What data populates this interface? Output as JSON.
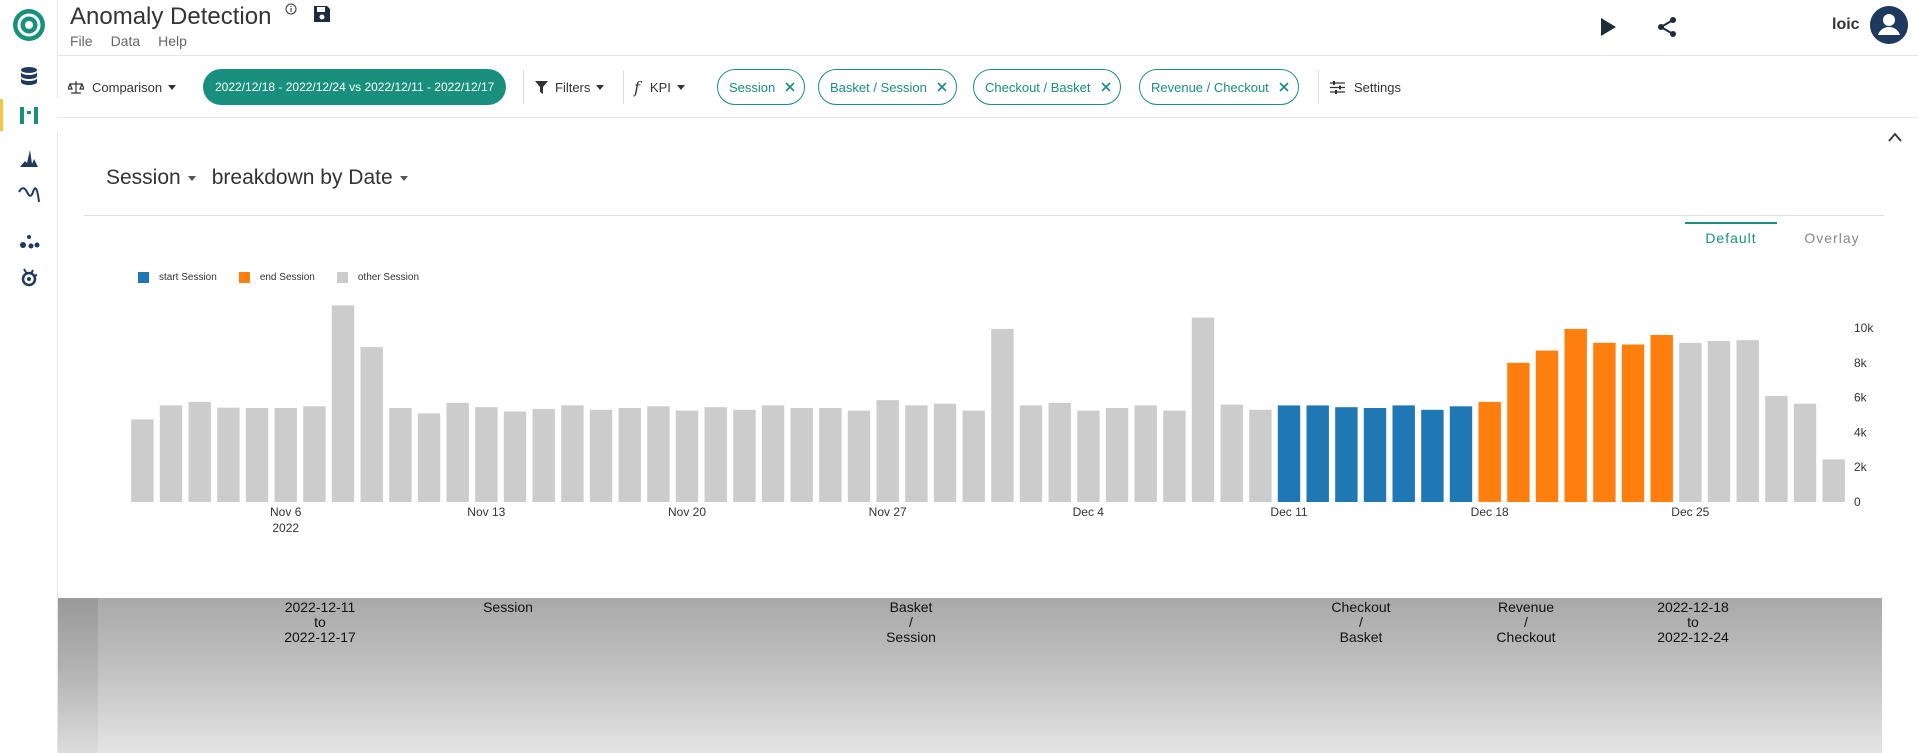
{
  "app": {
    "title": "Anomaly Detection",
    "menu": [
      "File",
      "Data",
      "Help"
    ],
    "user": "loic",
    "accent": "#19907e"
  },
  "toolbar": {
    "comparison_label": "Comparison",
    "date_range": "2022/12/18 - 2022/12/24 vs 2022/12/11 - 2022/12/17",
    "filters_label": "Filters",
    "kpi_label": "KPI",
    "chips": [
      "Session",
      "Basket / Session",
      "Checkout / Basket",
      "Revenue / Checkout"
    ],
    "settings_label": "Settings"
  },
  "panel": {
    "metric": "Session",
    "breakdown": "breakdown by Date",
    "view_tabs": [
      "Default",
      "Overlay"
    ],
    "active_tab": "Default"
  },
  "chart_data": {
    "type": "bar",
    "legend": [
      {
        "name": "start Session",
        "color": "#1f77b4"
      },
      {
        "name": "end Session",
        "color": "#ff7f0e"
      },
      {
        "name": "other Session",
        "color": "#cccccc"
      }
    ],
    "x_tick_labels": [
      {
        "label": "Nov 6",
        "sublabel": "2022",
        "index": 5
      },
      {
        "label": "Nov 13",
        "sublabel": "",
        "index": 12
      },
      {
        "label": "Nov 20",
        "sublabel": "",
        "index": 19
      },
      {
        "label": "Nov 27",
        "sublabel": "",
        "index": 26
      },
      {
        "label": "Dec 4",
        "sublabel": "",
        "index": 33
      },
      {
        "label": "Dec 11",
        "sublabel": "",
        "index": 40
      },
      {
        "label": "Dec 18",
        "sublabel": "",
        "index": 47
      },
      {
        "label": "Dec 25",
        "sublabel": "",
        "index": 54
      }
    ],
    "y_ticks": [
      "0",
      "2k",
      "4k",
      "6k",
      "8k",
      "10k"
    ],
    "ylim": [
      0,
      10000
    ],
    "y_axis_side": "right",
    "values": [
      4750,
      5550,
      5750,
      5420,
      5400,
      5400,
      5500,
      11300,
      8900,
      5400,
      5100,
      5700,
      5450,
      5200,
      5350,
      5550,
      5300,
      5400,
      5500,
      5250,
      5450,
      5300,
      5550,
      5400,
      5400,
      5250,
      5850,
      5550,
      5650,
      5250,
      9950,
      5550,
      5700,
      5250,
      5400,
      5550,
      5250,
      10600,
      5600,
      5300,
      5550,
      5550,
      5450,
      5400,
      5550,
      5300,
      5500,
      5750,
      8000,
      8700,
      9950,
      9150,
      9050,
      9600,
      9150,
      9250,
      9300,
      6100,
      5650,
      2450
    ],
    "groups": [
      "other",
      "other",
      "other",
      "other",
      "other",
      "other",
      "other",
      "other",
      "other",
      "other",
      "other",
      "other",
      "other",
      "other",
      "other",
      "other",
      "other",
      "other",
      "other",
      "other",
      "other",
      "other",
      "other",
      "other",
      "other",
      "other",
      "other",
      "other",
      "other",
      "other",
      "other",
      "other",
      "other",
      "other",
      "other",
      "other",
      "other",
      "other",
      "other",
      "other",
      "start",
      "start",
      "start",
      "start",
      "start",
      "start",
      "start",
      "end",
      "end",
      "end",
      "end",
      "end",
      "end",
      "end",
      "other",
      "other",
      "other",
      "other",
      "other",
      "other"
    ]
  },
  "table": {
    "headers": [
      "2022-12-11\nto\n2022-12-17",
      "Session",
      "Basket\n/\nSession",
      "Checkout\n/\nBasket",
      "Revenue\n/\nCheckout",
      "2022-12-18\nto\n2022-12-24"
    ]
  }
}
